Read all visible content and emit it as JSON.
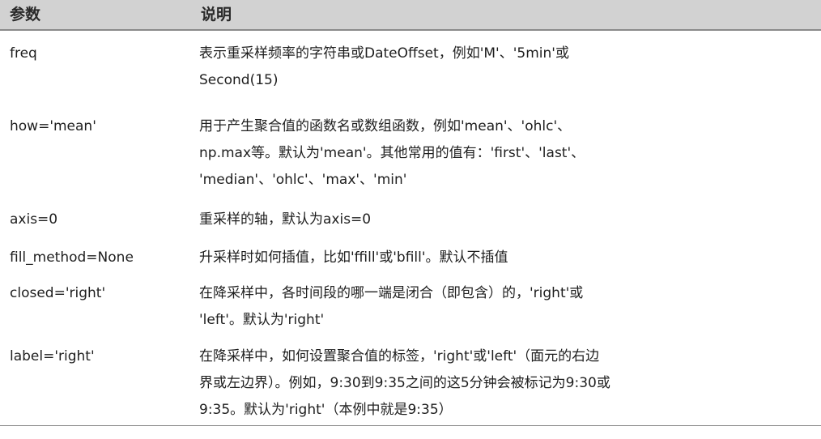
{
  "header": {
    "param_label": "参数",
    "desc_label": "说明"
  },
  "rows": [
    {
      "param": "freq",
      "desc_lines": [
        "表示重采样频率的字符串或DateOffset，例如'M'、'5min'或",
        "Second(15)"
      ]
    },
    {
      "param": "how='mean'",
      "desc_lines": [
        "用于产生聚合值的函数名或数组函数，例如'mean'、'ohlc'、",
        "np.max等。默认为'mean'。其他常用的值有：'first'、'last'、",
        "'median'、'ohlc'、'max'、'min'"
      ]
    },
    {
      "param": "axis=0",
      "desc_lines": [
        "重采样的轴，默认为axis=0"
      ]
    },
    {
      "param": "fill_method=None",
      "desc_lines": [
        "升采样时如何插值，比如'ffill'或'bfill'。默认不插值"
      ]
    },
    {
      "param": "closed='right'",
      "desc_lines": [
        "在降采样中，各时间段的哪一端是闭合（即包含）的，'right'或",
        "'left'。默认为'right'"
      ]
    },
    {
      "param": "label='right'",
      "desc_lines": [
        "在降采样中，如何设置聚合值的标签，'right'或'left'（面元的右边",
        "界或左边界）。例如，9:30到9:35之间的这5分钟会被标记为9:30或",
        "9:35。默认为'right'（本例中就是9:35）"
      ]
    }
  ]
}
